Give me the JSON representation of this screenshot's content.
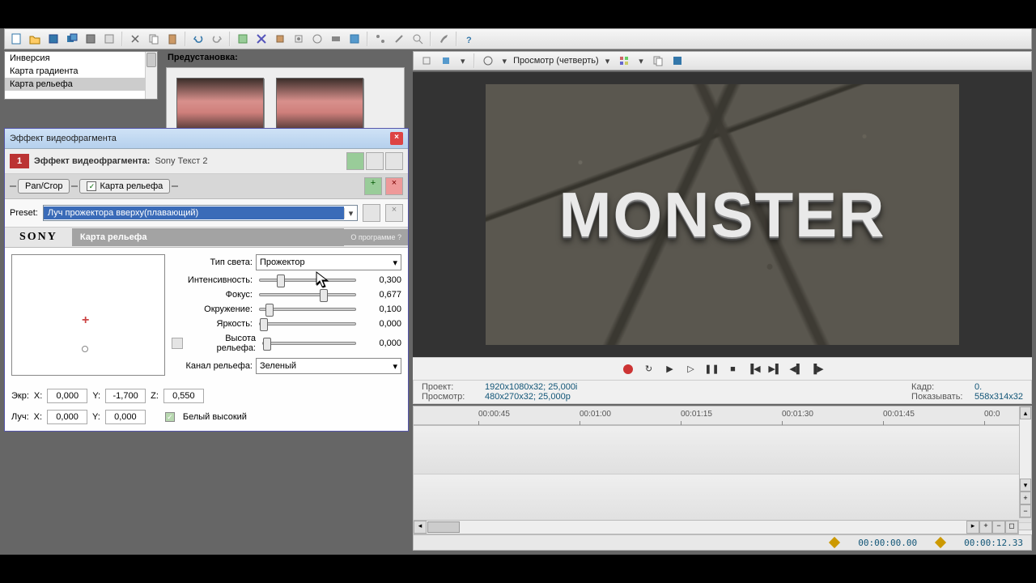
{
  "fx_list": {
    "items": [
      "Инверсия",
      "Карта градиента",
      "Карта рельефа"
    ],
    "selected": 2
  },
  "preset_label": "Предустановка:",
  "dialog": {
    "title": "Эффект видеофрагмента",
    "row1_label": "Эффект видеофрагмента:",
    "row1_value": "Sony Текст 2",
    "chain": {
      "node1": "Pan/Crop",
      "node2": "Карта рельефа"
    },
    "preset_lbl": "Preset:",
    "preset_val": "Луч прожектора вверху(плавающий)",
    "sony": {
      "logo": "SONY",
      "name": "Карта рельефа",
      "about": "О программе ?"
    },
    "params": {
      "light_type": {
        "label": "Тип света:",
        "value": "Прожектор"
      },
      "intensity": {
        "label": "Интенсивность:",
        "value": "0,300",
        "pct": 18
      },
      "focus": {
        "label": "Фокус:",
        "value": "0,677",
        "pct": 63
      },
      "ambient": {
        "label": "Окружение:",
        "value": "0,100",
        "pct": 6
      },
      "brightness": {
        "label": "Яркость:",
        "value": "0,000",
        "pct": 0
      },
      "height": {
        "label": "Высота рельефа:",
        "value": "0,000",
        "pct": 0
      },
      "channel": {
        "label": "Канал рельефа:",
        "value": "Зеленый"
      }
    },
    "coords": {
      "ekr": "Экр:",
      "x": "X:",
      "y": "Y:",
      "z": "Z:",
      "ekr_x": "0,000",
      "ekr_y": "-1,700",
      "ekr_z": "0,550",
      "luch": "Луч:",
      "luch_x": "0,000",
      "luch_y": "0,000",
      "check": "Белый высокий"
    }
  },
  "preview": {
    "label": "Просмотр (четверть)",
    "text": "MONSTER",
    "info": {
      "project_lbl": "Проект:",
      "project_val": "1920x1080x32; 25,000i",
      "view_lbl": "Просмотр:",
      "view_val": "480x270x32; 25,000p",
      "frame_lbl": "Кадр:",
      "frame_val": "0.",
      "show_lbl": "Показывать:",
      "show_val": "558x314x32"
    }
  },
  "timeline": {
    "ticks": [
      "00:00:45",
      "00:01:00",
      "00:01:15",
      "00:01:30",
      "00:01:45",
      "00:0"
    ]
  },
  "status": {
    "time1": "00:00:00.00",
    "time2": "00:00:12.33"
  }
}
